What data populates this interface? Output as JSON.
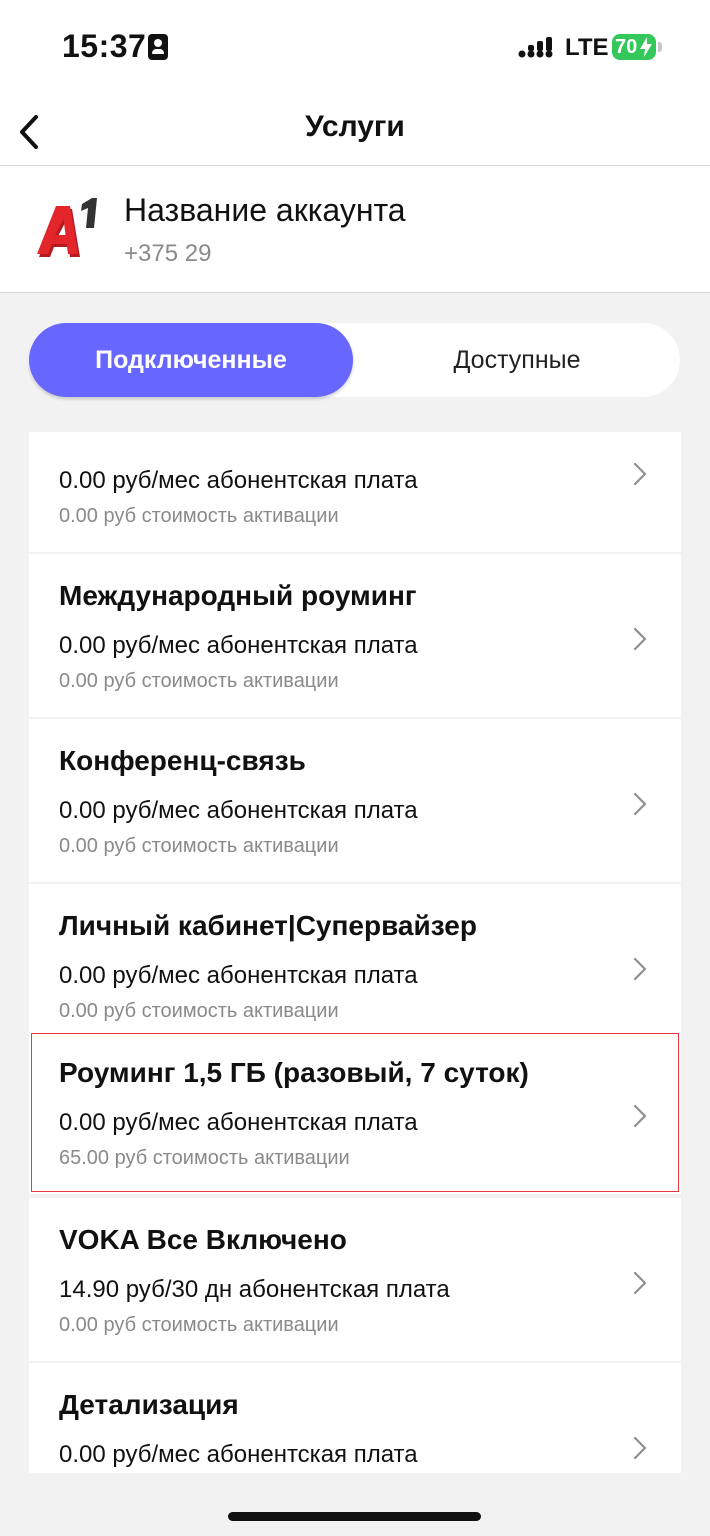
{
  "status_bar": {
    "time": "15:37",
    "network": "LTE",
    "battery": "70"
  },
  "header": {
    "title": "Услуги"
  },
  "account": {
    "name": "Название аккаунта",
    "phone": "+375 29"
  },
  "tabs": [
    {
      "label": "Подключенные",
      "active": true
    },
    {
      "label": "Доступные",
      "active": false
    }
  ],
  "services": [
    {
      "title": "",
      "fee": "0.00 руб/мес абонентская плата",
      "activation": "0.00 руб стоимость активации"
    },
    {
      "title": "Международный роуминг",
      "fee": "0.00 руб/мес абонентская плата",
      "activation": "0.00 руб стоимость активации"
    },
    {
      "title": "Конференц-связь",
      "fee": "0.00 руб/мес абонентская плата",
      "activation": "0.00 руб стоимость активации"
    },
    {
      "title": "Личный кабинет|Супервайзер",
      "fee": "0.00 руб/мес абонентская плата",
      "activation": "0.00 руб стоимость активации"
    },
    {
      "title": "Роуминг 1,5 ГБ (разовый, 7 суток)",
      "fee": "0.00 руб/мес абонентская плата",
      "activation": "65.00 руб стоимость активации"
    },
    {
      "title": "VOKA Все Включено",
      "fee": "14.90 руб/30 дн абонентская плата",
      "activation": "0.00 руб стоимость активации"
    },
    {
      "title": "Детализация",
      "fee": "0.00 руб/мес абонентская плата",
      "activation": ""
    }
  ],
  "colors": {
    "accent": "#6766ff",
    "brand_red": "#e3262b",
    "highlight_border": "#e8383d",
    "battery_green": "#34c759"
  },
  "icons": {
    "back": "chevron-left-icon",
    "row": "chevron-right-icon",
    "logo": "a1-logo-icon"
  }
}
